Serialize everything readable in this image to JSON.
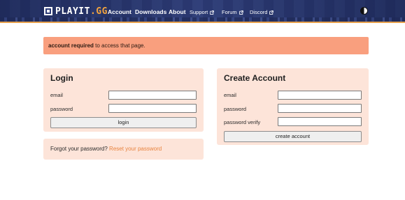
{
  "header": {
    "logo": {
      "text_main": "PLAYIT",
      "text_accent": ".GG"
    },
    "nav": [
      {
        "label": "Account",
        "external": false
      },
      {
        "label": "Downloads",
        "external": false
      },
      {
        "label": "About",
        "external": false
      },
      {
        "label": "Support",
        "external": true
      },
      {
        "label": "Forum",
        "external": true
      },
      {
        "label": "Discord",
        "external": true
      }
    ],
    "theme_toggle_icon": "contrast-icon"
  },
  "alert": {
    "bold_text": "account required",
    "text": " to access that page."
  },
  "login": {
    "title": "Login",
    "email_label": "email",
    "email_value": "",
    "password_label": "password",
    "password_value": "",
    "button_label": "login"
  },
  "forgot": {
    "text": "Forgot your password? ",
    "link": "Reset your password"
  },
  "create": {
    "title": "Create Account",
    "email_label": "email",
    "email_value": "",
    "password_label": "password",
    "password_value": "",
    "password_verify_label": "password verify",
    "password_verify_value": "",
    "button_label": "create account"
  },
  "colors": {
    "header_bg": "#2f3d78",
    "accent": "#f3a43f",
    "alert_bg": "#f99f7e",
    "card_bg": "#fde4d9",
    "link": "#e8833e"
  }
}
